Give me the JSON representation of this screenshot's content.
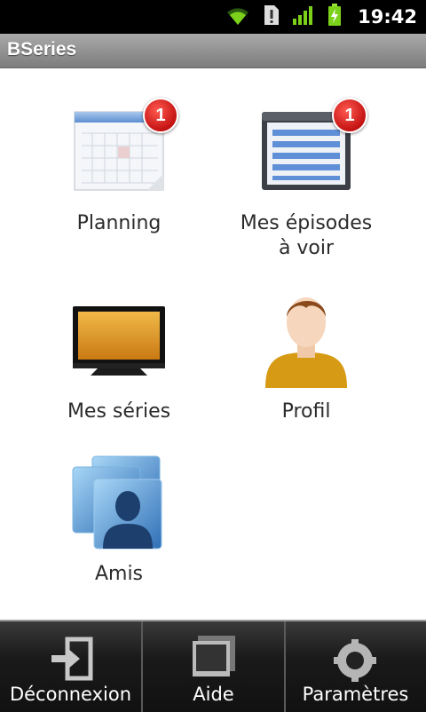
{
  "status_bar": {
    "time": "19:42"
  },
  "app": {
    "title": "BSeries"
  },
  "tiles": [
    {
      "label": "Planning",
      "badge": "1"
    },
    {
      "label": "Mes épisodes à voir",
      "badge": "1"
    },
    {
      "label": "Mes séries"
    },
    {
      "label": "Profil"
    },
    {
      "label": "Amis"
    }
  ],
  "bottom_bar": {
    "logout": "Déconnexion",
    "help": "Aide",
    "settings": "Paramètres"
  },
  "colors": {
    "badge": "#d8201a",
    "title_bar": "#8c8c8c",
    "tv_screen": "#e0a030",
    "shirt": "#d79a14"
  }
}
